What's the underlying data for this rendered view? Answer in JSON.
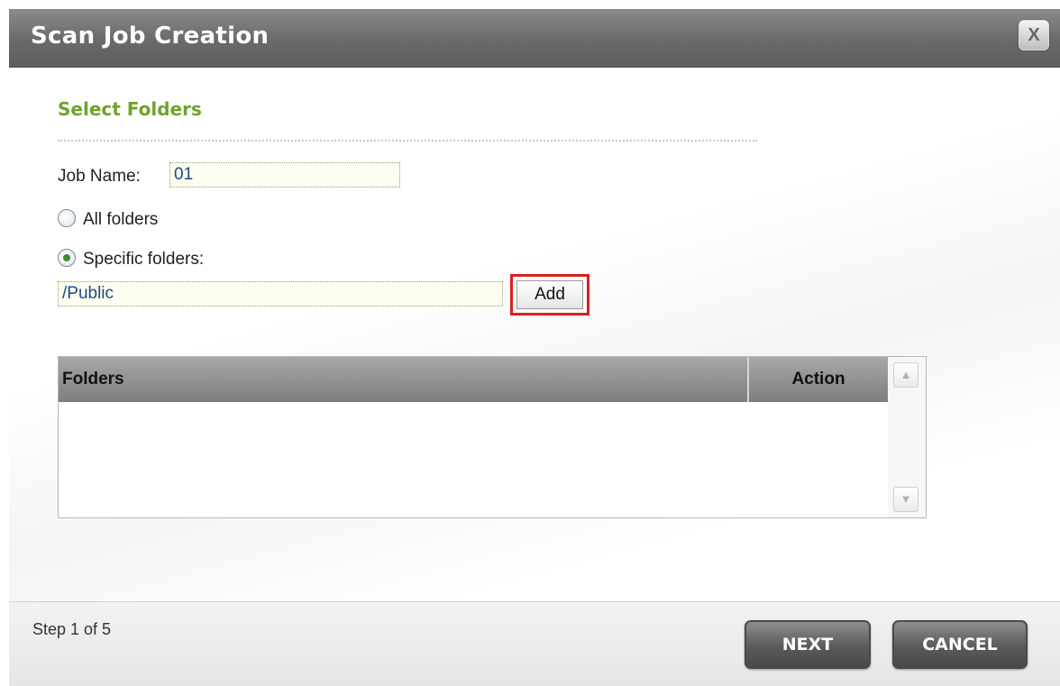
{
  "dialog": {
    "title": "Scan Job Creation",
    "close_label": "X"
  },
  "section": {
    "title": "Select Folders"
  },
  "form": {
    "job_name_label": "Job Name:",
    "job_name_value": "01",
    "all_folders_label": "All folders",
    "all_folders_selected": false,
    "specific_folders_label": "Specific folders:",
    "specific_folders_selected": true,
    "folder_path_value": "/Public",
    "add_button_label": "Add"
  },
  "table": {
    "columns": [
      "Folders",
      "Action"
    ],
    "rows": []
  },
  "footer": {
    "step_text": "Step 1 of 5",
    "next_label": "NEXT",
    "cancel_label": "CANCEL"
  },
  "colors": {
    "section_title": "#6fa32a",
    "highlight_border": "#dd1f1f",
    "input_text": "#1c4a8a"
  }
}
